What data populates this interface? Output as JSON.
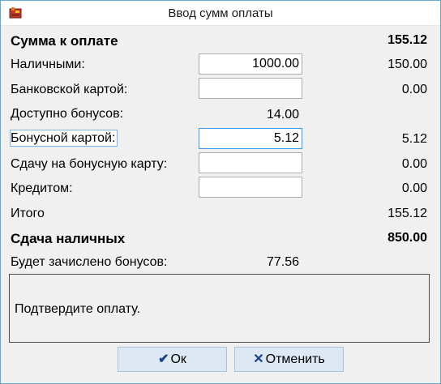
{
  "window": {
    "title": "Ввод сумм оплаты"
  },
  "form": {
    "total_due": {
      "label": "Сумма к оплате",
      "value": "155.12"
    },
    "cash": {
      "label": "Наличными:",
      "input": "1000.00",
      "value": "150.00"
    },
    "bank_card": {
      "label": "Банковской картой:",
      "input": "",
      "value": "0.00"
    },
    "bonus_available": {
      "label": "Доступно бонусов:",
      "value": "14.00"
    },
    "bonus_card": {
      "label": "Бонусной картой:",
      "input": "5.12",
      "value": "5.12"
    },
    "change_to_bonus": {
      "label": "Сдачу на бонусную карту:",
      "input": "",
      "value": "0.00"
    },
    "credit": {
      "label": "Кредитом:",
      "input": "",
      "value": "0.00"
    },
    "total": {
      "label": "Итого",
      "value": "155.12"
    },
    "cash_change": {
      "label": "Сдача наличных",
      "value": "850.00"
    },
    "bonus_credited": {
      "label": "Будет зачислено бонусов:",
      "value": "77.56"
    }
  },
  "message": {
    "text": "Подтвердите оплату."
  },
  "buttons": {
    "ok": {
      "icon": "check-icon",
      "label": "Ок",
      "glyph": "✔"
    },
    "cancel": {
      "icon": "x-icon",
      "label": "Отменить",
      "glyph": "✕"
    }
  },
  "colors": {
    "window_border": "#5fa9d9",
    "button_bg": "#dde8f4",
    "focus_border": "#3399ff"
  }
}
